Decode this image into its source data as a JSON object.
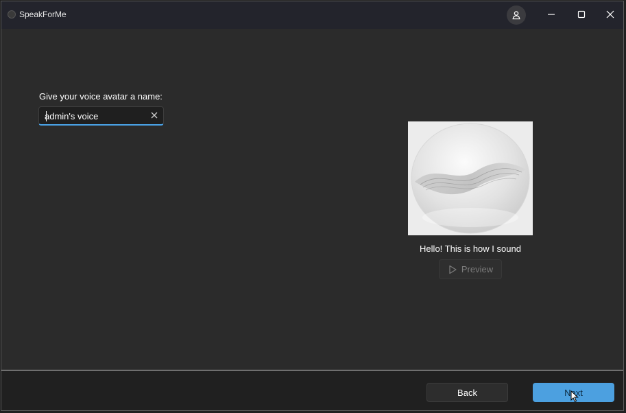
{
  "window": {
    "title": "SpeakForMe"
  },
  "titlebar_icons": {
    "account": "account-icon",
    "minimize": "minimize-icon",
    "maximize": "maximize-icon",
    "close": "close-icon"
  },
  "form": {
    "name_label": "Give your voice avatar a name:",
    "name_value": "admin's voice",
    "clear_icon": "clear-icon"
  },
  "avatar": {
    "caption": "Hello! This is how I sound",
    "preview_label": "Preview",
    "preview_icon": "play-icon"
  },
  "footer": {
    "back_label": "Back",
    "next_label": "Next"
  },
  "colors": {
    "accent": "#4ca0e0",
    "background": "#2b2b2b",
    "titlebar": "#23242c"
  }
}
